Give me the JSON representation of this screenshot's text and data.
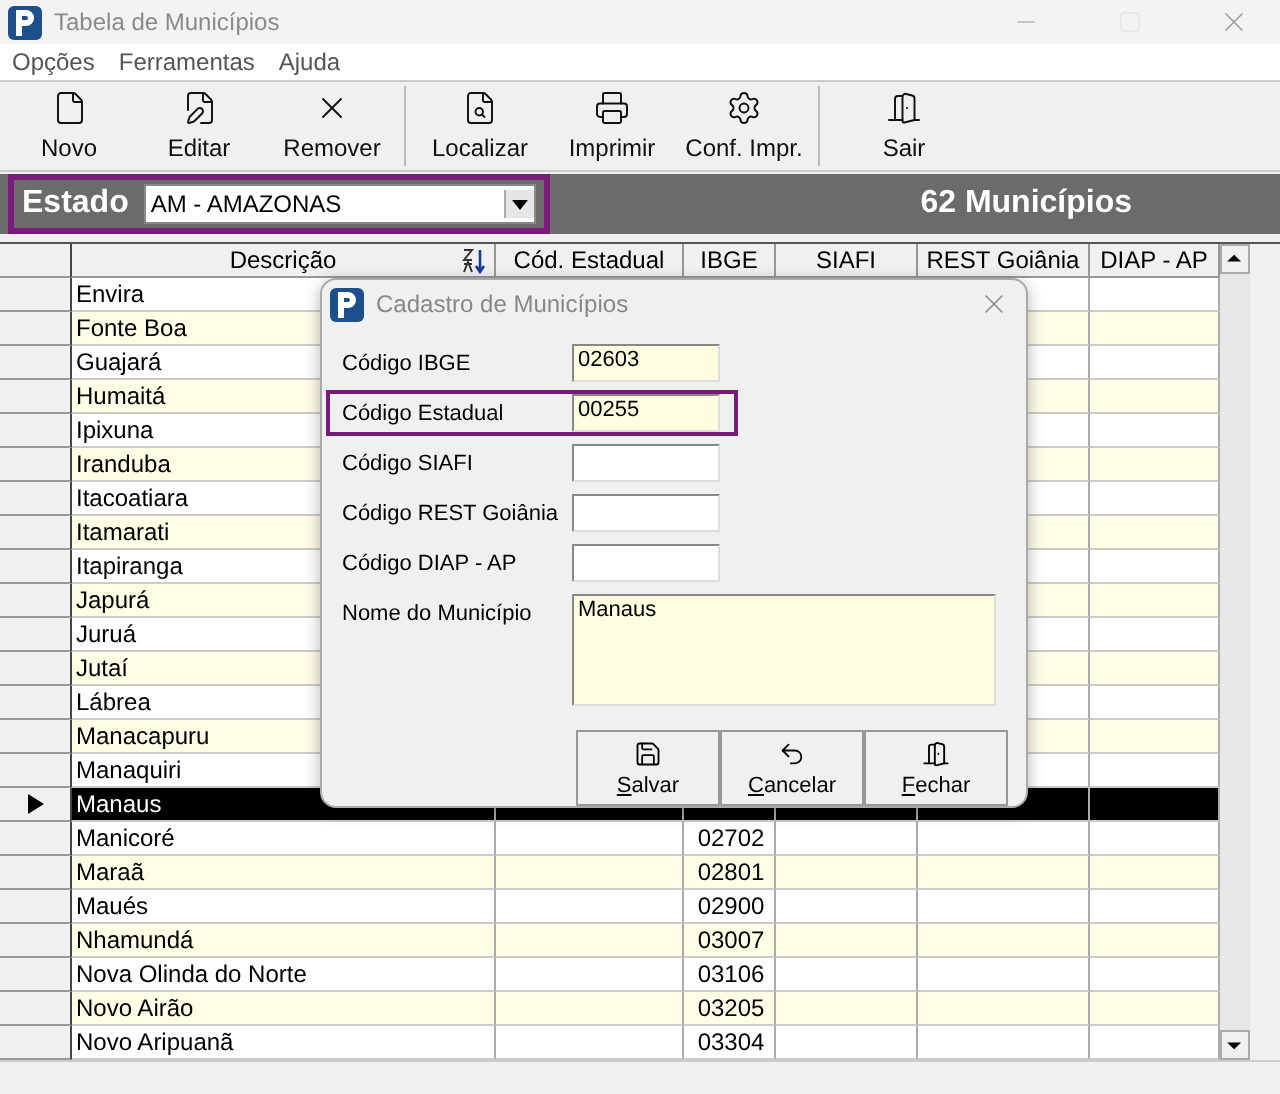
{
  "window": {
    "title": "Tabela de Municípios"
  },
  "menu": [
    "Opções",
    "Ferramentas",
    "Ajuda"
  ],
  "toolbar": [
    [
      {
        "label": "Novo",
        "kind": "new"
      },
      {
        "label": "Editar",
        "kind": "edit"
      },
      {
        "label": "Remover",
        "kind": "remove"
      }
    ],
    [
      {
        "label": "Localizar",
        "kind": "find"
      },
      {
        "label": "Imprimir",
        "kind": "print"
      },
      {
        "label": "Conf. Impr.",
        "kind": "printsetup"
      }
    ],
    [
      {
        "label": "Sair",
        "kind": "exit"
      }
    ]
  ],
  "filter": {
    "label": "Estado",
    "value": "AM - AMAZONAS",
    "highlighted": true
  },
  "count": "62 Municípios",
  "grid": {
    "columns": [
      {
        "label": "Descrição",
        "sorted": true
      },
      {
        "label": "Cód. Estadual",
        "sorted": false
      },
      {
        "label": "IBGE",
        "sorted": false
      },
      {
        "label": "SIAFI",
        "sorted": false
      },
      {
        "label": "REST Goiânia",
        "sorted": false
      },
      {
        "label": "DIAP - AP",
        "sorted": false
      }
    ],
    "rows": [
      {
        "name": "Envira",
        "selected": false
      },
      {
        "name": "Fonte Boa",
        "selected": false
      },
      {
        "name": "Guajará",
        "selected": false
      },
      {
        "name": "Humaitá",
        "selected": false
      },
      {
        "name": "Ipixuna",
        "selected": false
      },
      {
        "name": "Iranduba",
        "selected": false
      },
      {
        "name": "Itacoatiara",
        "selected": false
      },
      {
        "name": "Itamarati",
        "selected": false
      },
      {
        "name": "Itapiranga",
        "selected": false
      },
      {
        "name": "Japurá",
        "selected": false
      },
      {
        "name": "Juruá",
        "selected": false
      },
      {
        "name": "Jutaí",
        "selected": false
      },
      {
        "name": "Lábrea",
        "selected": false
      },
      {
        "name": "Manacapuru",
        "selected": false
      },
      {
        "name": "Manaquiri",
        "selected": false
      },
      {
        "name": "Manaus",
        "selected": true
      },
      {
        "name": "Manicoré",
        "ibge": "02702",
        "selected": false
      },
      {
        "name": "Maraã",
        "ibge": "02801",
        "selected": false
      },
      {
        "name": "Maués",
        "ibge": "02900",
        "selected": false
      },
      {
        "name": "Nhamundá",
        "ibge": "03007",
        "selected": false
      },
      {
        "name": "Nova Olinda do Norte",
        "ibge": "03106",
        "selected": false
      },
      {
        "name": "Novo Airão",
        "ibge": "03205",
        "selected": false
      },
      {
        "name": "Novo Aripuanã",
        "ibge": "03304",
        "selected": false
      }
    ]
  },
  "dialog": {
    "title": "Cadastro de Municípios",
    "fields": [
      {
        "label": "Código IBGE",
        "value": "02603",
        "kind": "text",
        "highlighted": false
      },
      {
        "label": "Código Estadual",
        "value": "00255",
        "kind": "text",
        "highlighted": true
      },
      {
        "label": "Código SIAFI",
        "kind": "text",
        "highlighted": false
      },
      {
        "label": "Código REST Goiânia",
        "kind": "text",
        "highlighted": false
      },
      {
        "label": "Código DIAP - AP",
        "kind": "text",
        "highlighted": false
      },
      {
        "label": "Nome do Município",
        "value": "Manaus",
        "kind": "memo",
        "highlighted": false
      }
    ],
    "buttons": [
      {
        "label": "Salvar",
        "kind": "save"
      },
      {
        "label": "Cancelar",
        "kind": "cancel"
      },
      {
        "label": "Fechar",
        "kind": "close"
      }
    ]
  }
}
